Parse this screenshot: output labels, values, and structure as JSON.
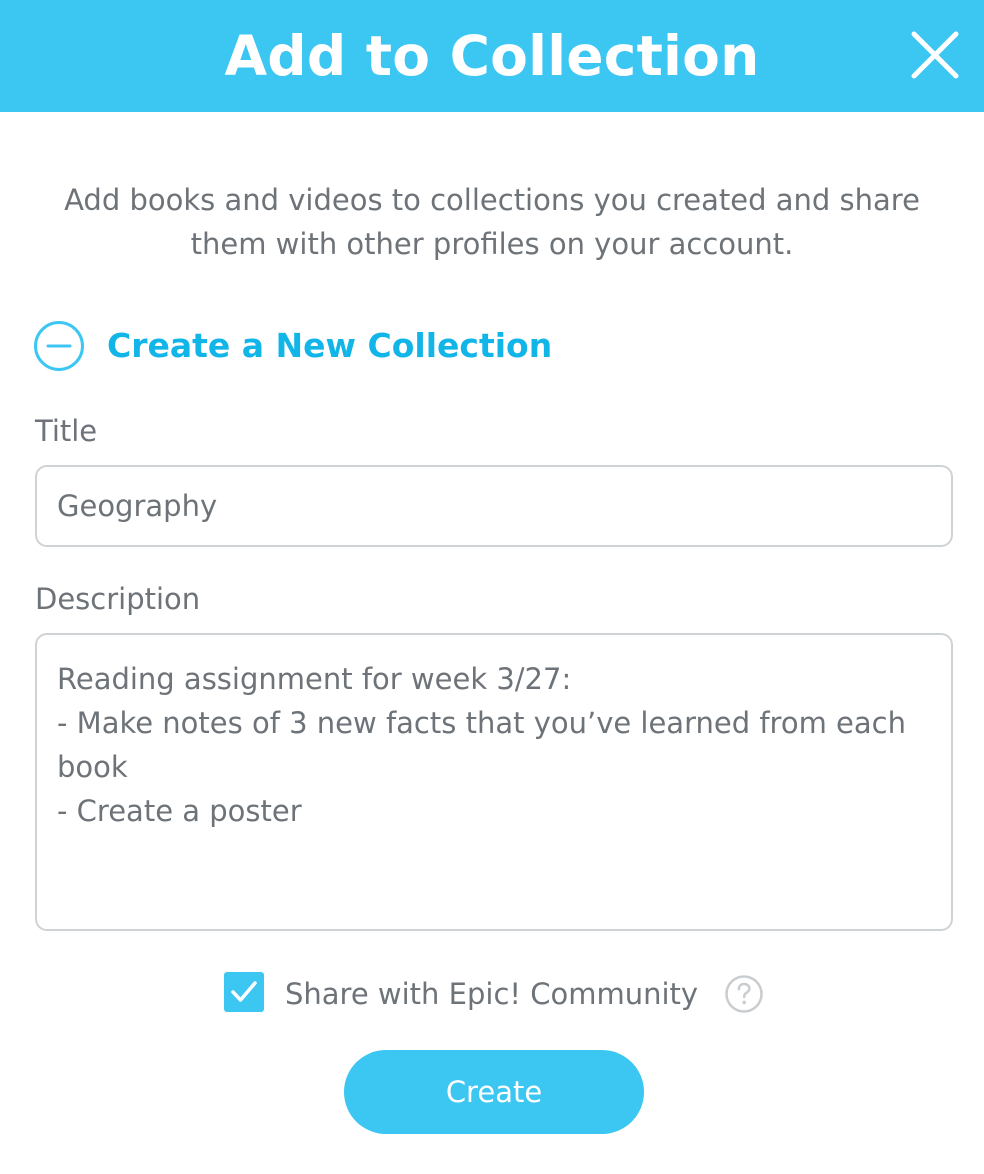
{
  "header": {
    "title": "Add to Collection",
    "close_icon": "close-icon",
    "background_color": "#3cc6f2"
  },
  "intro_text": "Add books and videos to collections you created and share them with other profiles on your account.",
  "create_section": {
    "label": "Create a New Collection",
    "icon": "minus-circle-icon",
    "expanded": true,
    "accent_color": "#12b5e8"
  },
  "form": {
    "title_label": "Title",
    "title_value": "Geography",
    "description_label": "Description",
    "description_value": "Reading assignment for week 3/27:\n- Make notes of 3 new facts that you’ve learned from each book\n- Create a poster"
  },
  "share": {
    "label": "Share with Epic! Community",
    "checked": true,
    "help_icon": "question-circle-icon"
  },
  "actions": {
    "create_label": "Create"
  }
}
